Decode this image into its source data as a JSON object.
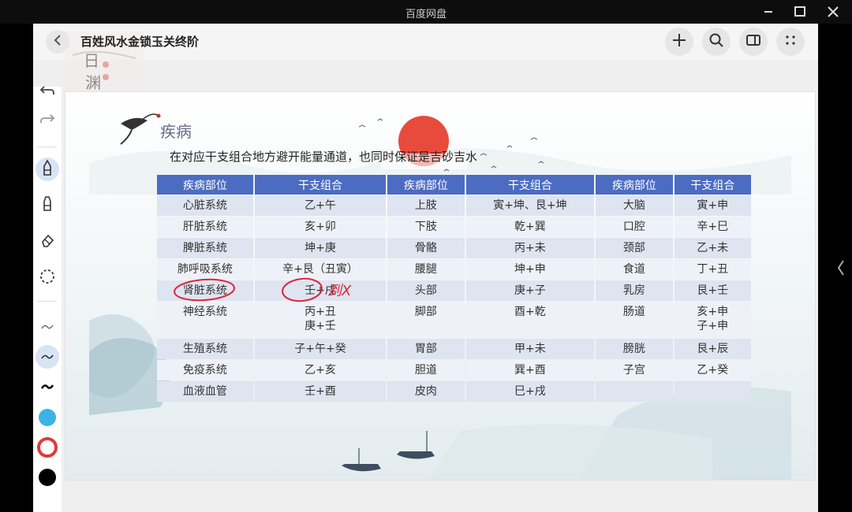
{
  "window": {
    "title": "百度网盘"
  },
  "viewer": {
    "doc_title": "百姓风水金锁玉关终阶",
    "watermark_text": "日 渊"
  },
  "slide": {
    "title": "疾病",
    "subtitle": "在对应干支组合地方避开能量通道，也同时保证是吉砂吉水",
    "table": {
      "headers": [
        "疾病部位",
        "干支组合",
        "疾病部位",
        "干支组合",
        "疾病部位",
        "干支组合"
      ],
      "rows": [
        [
          "心脏系统",
          "乙+午",
          "上肢",
          "寅+坤、艮+坤",
          "大脑",
          "寅+申"
        ],
        [
          "肝脏系统",
          "亥+卯",
          "下肢",
          "乾+巽",
          "口腔",
          "辛+巳"
        ],
        [
          "脾脏系统",
          "坤+庚",
          "骨骼",
          "丙+未",
          "颈部",
          "乙+未"
        ],
        [
          "肺呼吸系统",
          "辛+艮（丑寅）",
          "腰腿",
          "坤+申",
          "食道",
          "丁+丑"
        ],
        [
          "肾脏系统",
          "壬+戌",
          "头部",
          "庚+子",
          "乳房",
          "艮+壬"
        ],
        [
          "神经系统",
          "丙+丑\n庚+壬",
          "脚部",
          "酉+乾",
          "肠道",
          "亥+申\n子+申"
        ],
        [
          "生殖系统",
          "子+午+癸",
          "胃部",
          "甲+未",
          "膀胱",
          "艮+辰"
        ],
        [
          "免疫系统",
          "乙+亥",
          "胆道",
          "巽+酉",
          "子宫",
          "乙+癸"
        ],
        [
          "血液血管",
          "壬+酉",
          "皮肉",
          "巳+戌",
          "",
          ""
        ]
      ]
    },
    "annotation": "到X"
  },
  "colors": {
    "header_blue": "#4b6cc1",
    "cell_light": "#dfe4f1",
    "annotation_red": "#d9273a",
    "sun_red": "#e84b3c",
    "swatch_blue": "#3bb4e5",
    "swatch_red": "#e03a3a"
  },
  "icons": [
    "back-icon",
    "plus-icon",
    "search-icon",
    "panel-icon",
    "more-icon",
    "undo-icon",
    "redo-icon",
    "pen-icon",
    "highlighter-icon",
    "eraser-icon",
    "lasso-icon"
  ]
}
